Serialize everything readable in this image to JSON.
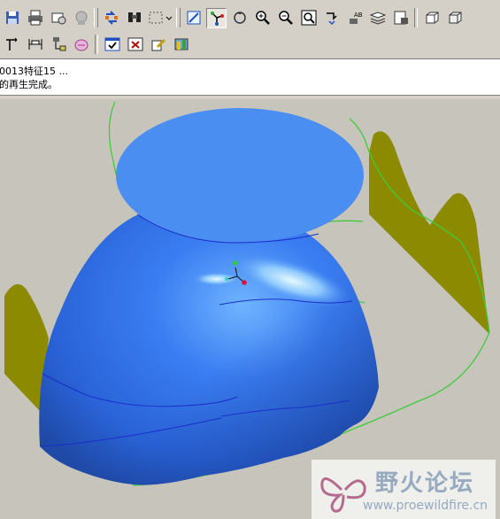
{
  "message_area": {
    "line1": "0013特征15 ...",
    "line2": "的再生完成。"
  },
  "watermark": {
    "title": "野火论坛",
    "url": "www.proewildfire.cn"
  },
  "toolbar": {
    "row1_icons": [
      "save-icon",
      "print-icon",
      "send-mail-icon",
      "email-icon",
      "regenerate-icon",
      "find-icon",
      "select-box-icon",
      "dropdown-arrow-icon",
      "redraw-icon",
      "spin-center-icon",
      "orient-mode-icon",
      "zoom-in-icon",
      "zoom-out-icon",
      "refit-icon",
      "view-manager-icon",
      "saved-views-icon",
      "layers-icon",
      "model-setup-icon",
      "shading-icon",
      "shading-edges-icon"
    ],
    "row2_icons": [
      "datum-axis-icon",
      "dimension-icon",
      "model-tree-icon",
      "appearance-icon",
      "check-icon",
      "close-icon",
      "edit-icon",
      "analysis-icon"
    ],
    "active_tool": "spin-center-icon"
  },
  "colors": {
    "surface": "#2f6ef0",
    "datum_plane": "#8b8a00",
    "curve_green": "#3ecb3e",
    "background": "#c7c4bb"
  }
}
